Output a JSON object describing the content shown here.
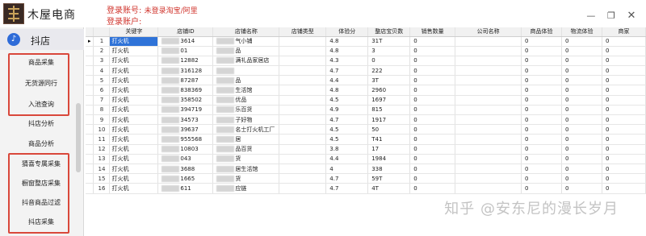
{
  "app": {
    "title": "木屋电商"
  },
  "platform": {
    "label": "抖店",
    "icon": "tiktok-icon"
  },
  "sidebar": {
    "items": [
      {
        "label": "商品采集"
      },
      {
        "label": "无货源同行"
      },
      {
        "label": "入池查询"
      },
      {
        "label": "抖店分析"
      },
      {
        "label": "商品分析"
      },
      {
        "label": "猜喜专属采集"
      },
      {
        "label": "橱窗整店采集"
      },
      {
        "label": "抖音商品过滤"
      },
      {
        "label": "抖店采集"
      }
    ]
  },
  "header": {
    "login_account_label": "登录账号:",
    "login_account_value": "未登录淘宝/阿里",
    "login_user_label": "登录账户:"
  },
  "window_controls": [
    "minimize-icon",
    "restore-icon",
    "close-icon"
  ],
  "grid": {
    "columns": [
      "",
      "",
      "关键字",
      "店铺ID",
      "店铺名称",
      "店铺类型",
      "体验分",
      "整店宝贝数",
      "销售数量",
      "公司名称",
      "商品体验",
      "物流体验",
      "商家"
    ],
    "rows": [
      {
        "no": "1",
        "kw": "打火机",
        "id": "3614",
        "name": "气小铺",
        "score": "4.8",
        "count": "31T",
        "sales": "0",
        "p": "0",
        "l": "0",
        "m": "0"
      },
      {
        "no": "2",
        "kw": "打火机",
        "id": "01",
        "name": "品",
        "score": "4.8",
        "count": "3",
        "sales": "0",
        "p": "0",
        "l": "0",
        "m": "0"
      },
      {
        "no": "3",
        "kw": "打火机",
        "id": "12882",
        "name": "满礼品家居店",
        "score": "4.3",
        "count": "0",
        "sales": "0",
        "p": "0",
        "l": "0",
        "m": "0"
      },
      {
        "no": "4",
        "kw": "打火机",
        "id": "316128",
        "name": "",
        "score": "4.7",
        "count": "222",
        "sales": "0",
        "p": "0",
        "l": "0",
        "m": "0"
      },
      {
        "no": "5",
        "kw": "打火机",
        "id": "87287",
        "name": "品",
        "score": "4.4",
        "count": "3T",
        "sales": "0",
        "p": "0",
        "l": "0",
        "m": "0"
      },
      {
        "no": "6",
        "kw": "打火机",
        "id": "838369",
        "name": "生活馆",
        "score": "4.8",
        "count": "2960",
        "sales": "0",
        "p": "0",
        "l": "0",
        "m": "0"
      },
      {
        "no": "7",
        "kw": "打火机",
        "id": "358502",
        "name": "优品",
        "score": "4.5",
        "count": "1697",
        "sales": "0",
        "p": "0",
        "l": "0",
        "m": "0"
      },
      {
        "no": "8",
        "kw": "打火机",
        "id": "394719",
        "name": "乐百货",
        "score": "4.9",
        "count": "815",
        "sales": "0",
        "p": "0",
        "l": "0",
        "m": "0"
      },
      {
        "no": "9",
        "kw": "打火机",
        "id": "34573",
        "name": "子好物",
        "score": "4.7",
        "count": "1917",
        "sales": "0",
        "p": "0",
        "l": "0",
        "m": "0"
      },
      {
        "no": "10",
        "kw": "打火机",
        "id": "39637",
        "name": "名士打火机工厂",
        "score": "4.5",
        "count": "50",
        "sales": "0",
        "p": "0",
        "l": "0",
        "m": "0"
      },
      {
        "no": "11",
        "kw": "打火机",
        "id": "955568",
        "name": "居",
        "score": "4.5",
        "count": "T41",
        "sales": "0",
        "p": "0",
        "l": "0",
        "m": "0"
      },
      {
        "no": "12",
        "kw": "打火机",
        "id": "10803",
        "name": "品百货",
        "score": "3.8",
        "count": "17",
        "sales": "0",
        "p": "0",
        "l": "0",
        "m": "0"
      },
      {
        "no": "13",
        "kw": "打火机",
        "id": "043",
        "name": "货",
        "score": "4.4",
        "count": "1984",
        "sales": "0",
        "p": "0",
        "l": "0",
        "m": "0"
      },
      {
        "no": "14",
        "kw": "打火机",
        "id": "3688",
        "name": "居生活馆",
        "score": "4",
        "count": "338",
        "sales": "0",
        "p": "0",
        "l": "0",
        "m": "0"
      },
      {
        "no": "15",
        "kw": "打火机",
        "id": "1665",
        "name": "货",
        "score": "4.7",
        "count": "59T",
        "sales": "0",
        "p": "0",
        "l": "0",
        "m": "0"
      },
      {
        "no": "16",
        "kw": "打火机",
        "id": "611",
        "name": "应链",
        "score": "4.7",
        "count": "4T",
        "sales": "0",
        "p": "0",
        "l": "0",
        "m": "0"
      }
    ]
  },
  "watermark": "知乎 @安东尼的漫长岁月",
  "colors": {
    "accent_red": "#d0342c",
    "selection_blue": "#2f73d8",
    "highlight_box": "#d9483b"
  }
}
